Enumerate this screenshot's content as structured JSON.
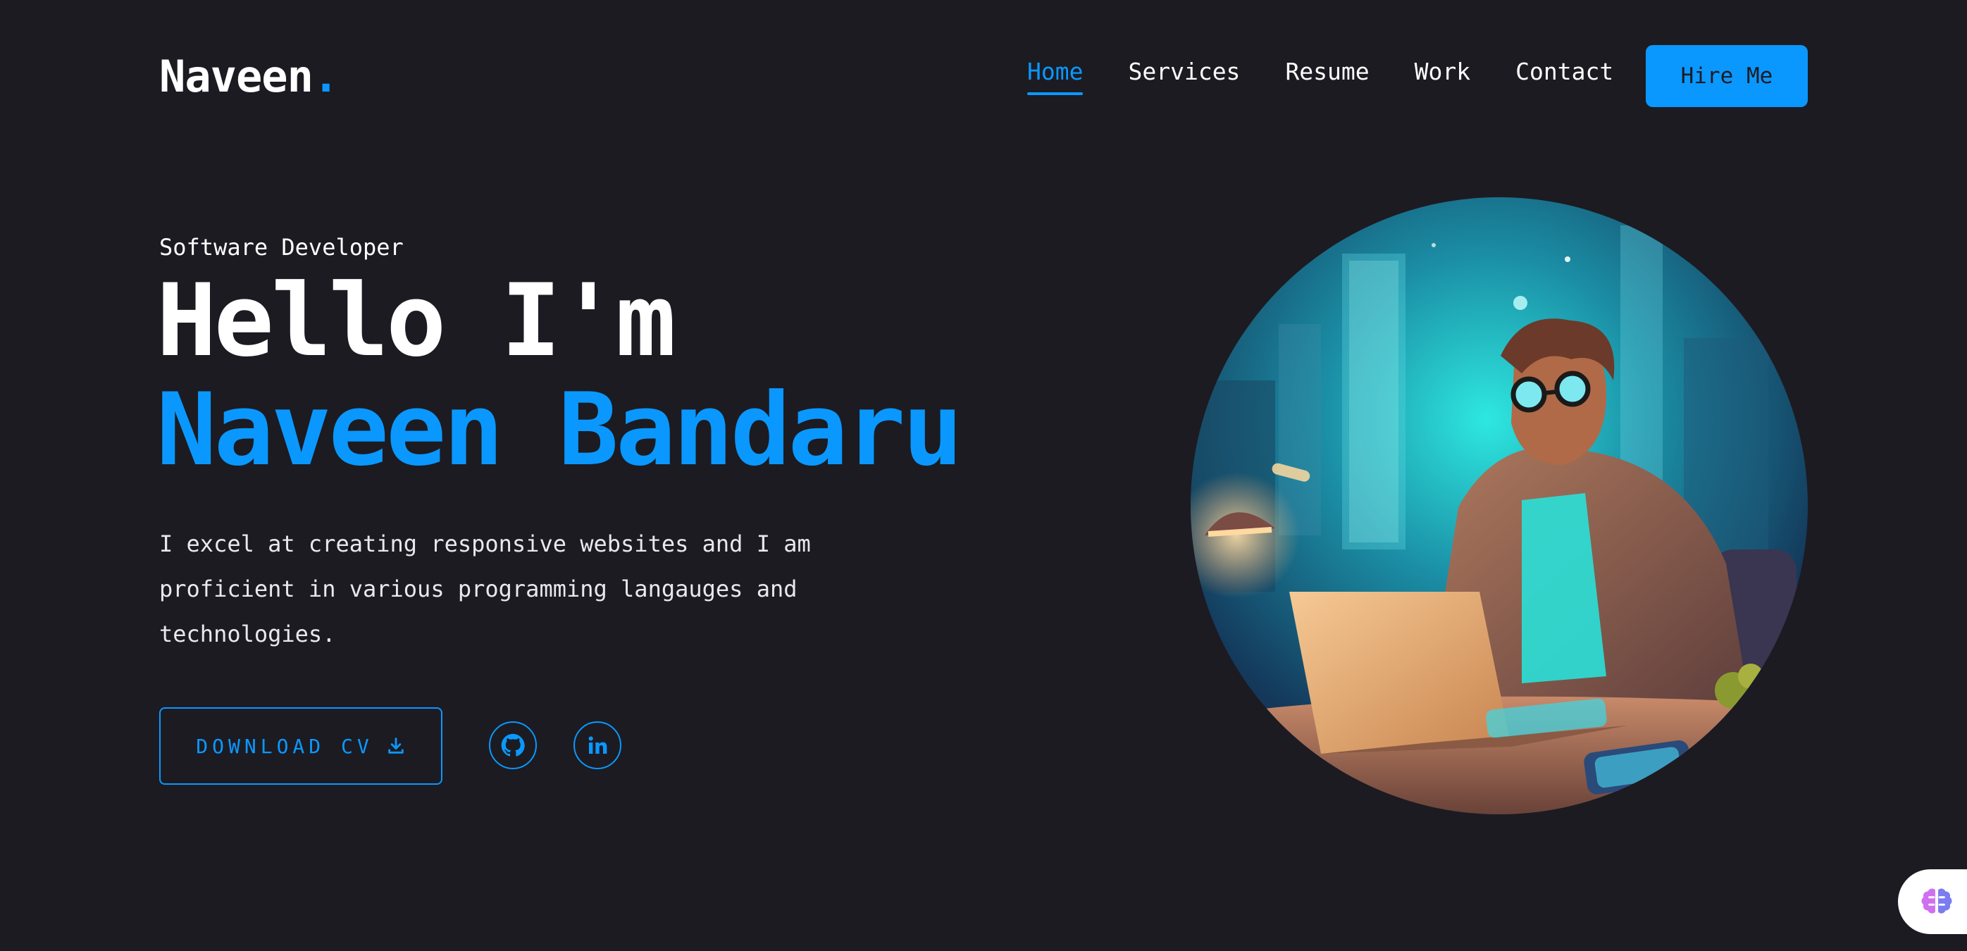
{
  "header": {
    "logo_text": "Naveen",
    "logo_dot": ".",
    "nav": [
      {
        "label": "Home",
        "active": true
      },
      {
        "label": "Services",
        "active": false
      },
      {
        "label": "Resume",
        "active": false
      },
      {
        "label": "Work",
        "active": false
      },
      {
        "label": "Contact",
        "active": false
      }
    ],
    "hire_label": "Hire Me"
  },
  "hero": {
    "role": "Software Developer",
    "greeting": "Hello I'm",
    "name": "Naveen Bandaru",
    "bio": "I excel at creating responsive websites and I am proficient in various programming langauges and technologies.",
    "cv_label": "DOWNLOAD CV",
    "cv_icon": "download-icon",
    "socials": [
      {
        "name": "github-icon"
      },
      {
        "name": "linkedin-icon"
      }
    ],
    "portrait": "developer-illustration"
  },
  "colors": {
    "background": "#1c1b22",
    "accent": "#0a98ff",
    "text": "#ffffff"
  },
  "floating_widget_icon": "brain-icon"
}
